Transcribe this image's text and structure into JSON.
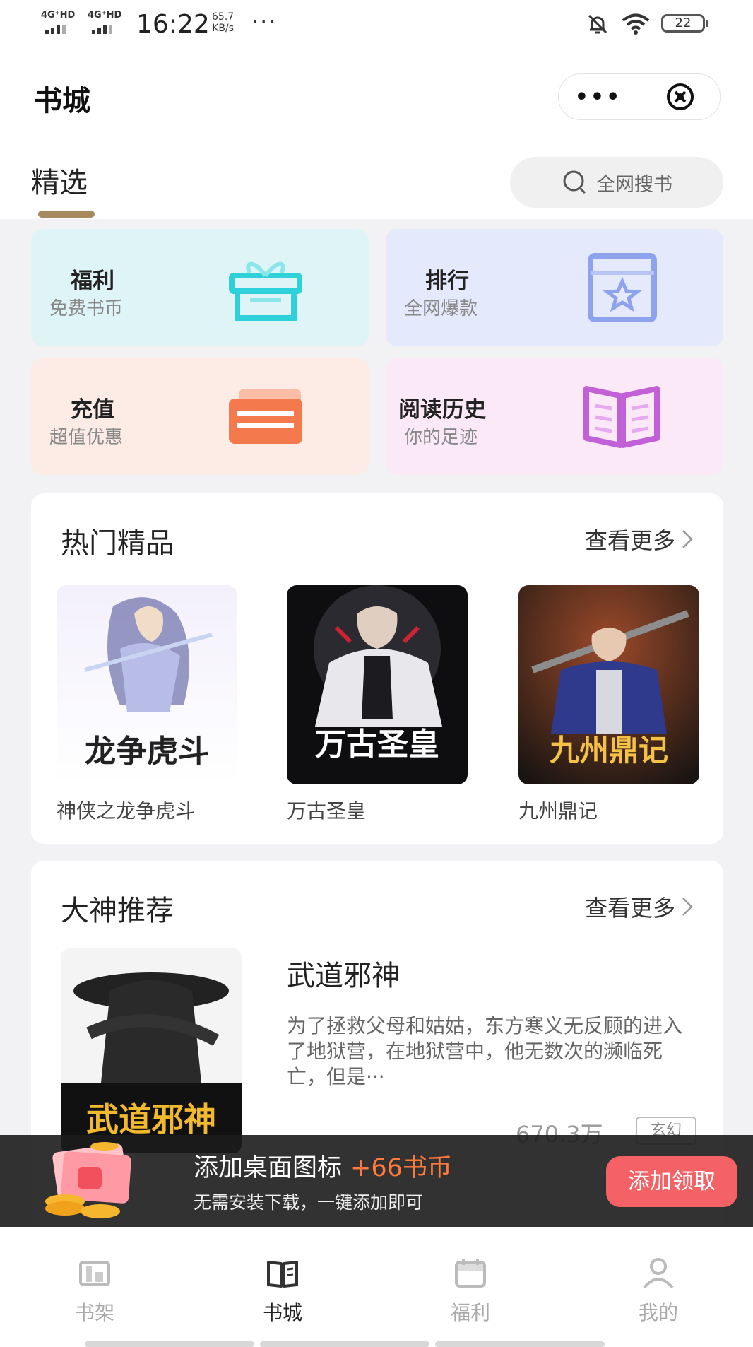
{
  "status_bar": {
    "signal1": "4G⁺HD",
    "signal2": "4G⁺HD",
    "time": "16:22",
    "speed_value": "65.7",
    "speed_unit": "KB/s",
    "dots": "···",
    "battery": "22"
  },
  "header": {
    "title": "书城",
    "menu_dots": "•••"
  },
  "tabs": [
    {
      "label": "精选",
      "active": true
    }
  ],
  "search": {
    "placeholder": "全网搜书"
  },
  "quick_cards": [
    {
      "title": "福利",
      "subtitle": "免费书币",
      "icon": "gift-icon",
      "bg": "#def4f6",
      "color": "#2ed0da"
    },
    {
      "title": "排行",
      "subtitle": "全网爆款",
      "icon": "ranking-icon",
      "bg": "#e4e9fb",
      "color": "#8ea3ee"
    },
    {
      "title": "充值",
      "subtitle": "超值优惠",
      "icon": "card-icon",
      "bg": "#fdece6",
      "color": "#f47a4e"
    },
    {
      "title": "阅读历史",
      "subtitle": "你的足迹",
      "icon": "book-open-icon",
      "bg": "#fbe9f8",
      "color": "#c260d8"
    }
  ],
  "hot_section": {
    "title": "热门精品",
    "more": "查看更多",
    "books": [
      {
        "name": "神侠之龙争虎斗",
        "cover_text": "龙争虎斗"
      },
      {
        "name": "万古圣皇",
        "cover_text": "万古圣皇"
      },
      {
        "name": "九州鼎记",
        "cover_text": "九州鼎记"
      }
    ]
  },
  "recommend_section": {
    "title": "大神推荐",
    "more": "查看更多",
    "book": {
      "title": "武道邪神",
      "cover_text": "武道邪神",
      "description": "为了拯救父母和姑姑，东方寒义无反顾的进入了地狱营，在地狱营中，他无数次的濒临死亡，但是···",
      "count": "670.3万",
      "tag": "玄幻"
    }
  },
  "banner": {
    "title": "添加桌面图标",
    "reward": "+66书币",
    "subtitle": "无需安装下载，一键添加即可",
    "button": "添加领取"
  },
  "bottom_nav": [
    {
      "label": "书架",
      "icon": "bookshelf-icon",
      "active": false
    },
    {
      "label": "书城",
      "icon": "bookstore-icon",
      "active": true
    },
    {
      "label": "福利",
      "icon": "calendar-icon",
      "active": false
    },
    {
      "label": "我的",
      "icon": "profile-icon",
      "active": false
    }
  ]
}
